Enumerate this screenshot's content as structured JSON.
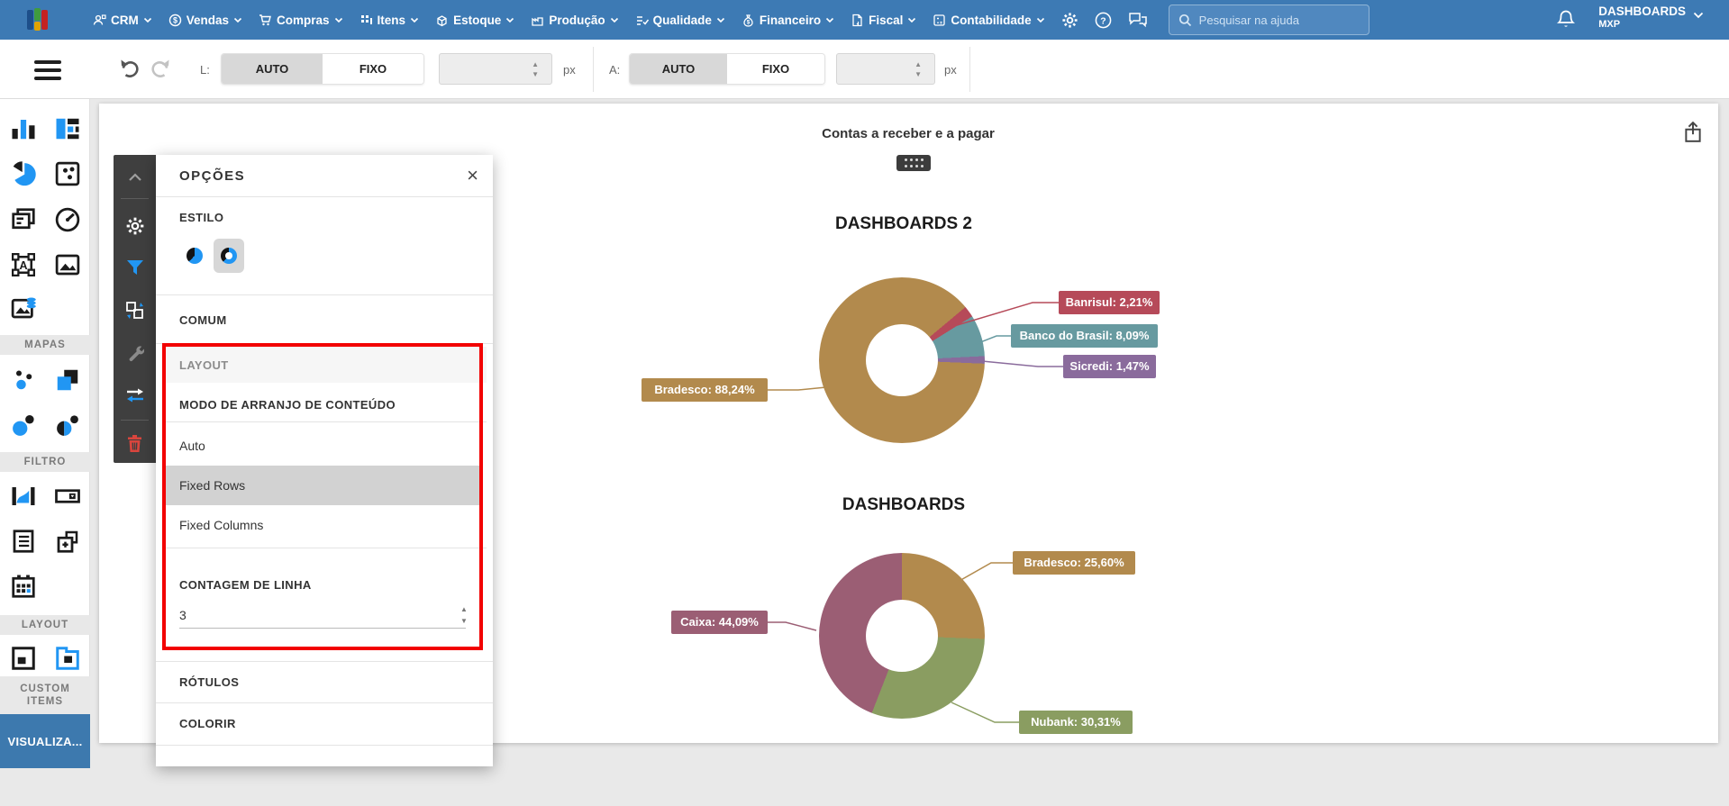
{
  "topbar": {
    "menus": [
      {
        "label": "CRM"
      },
      {
        "label": "Vendas"
      },
      {
        "label": "Compras"
      },
      {
        "label": "Itens"
      },
      {
        "label": "Estoque"
      },
      {
        "label": "Produção"
      },
      {
        "label": "Qualidade"
      },
      {
        "label": "Financeiro"
      },
      {
        "label": "Fiscal"
      },
      {
        "label": "Contabilidade"
      }
    ],
    "search": {
      "placeholder": "Pesquisar na ajuda"
    },
    "account": {
      "name": "DASHBOARDS",
      "org": "MXP"
    }
  },
  "toolbar": {
    "l_label": "L:",
    "a_label": "A:",
    "auto_label": "AUTO",
    "fixed_label": "FIXO",
    "px_label": "px"
  },
  "sidebar": {
    "section_labels": [
      "MAPAS",
      "FILTRO",
      "LAYOUT",
      "CUSTOM ITEMS"
    ],
    "visualize_label": "VISUALIZA..."
  },
  "options_panel": {
    "title": "OPÇÕES",
    "style_label": "ESTILO",
    "common_label": "COMUM",
    "layout_label": "LAYOUT",
    "arrange_label": "MODO DE ARRANJO DE CONTEÚDO",
    "arrange_options": [
      "Auto",
      "Fixed Rows",
      "Fixed Columns"
    ],
    "arrange_selected": "Fixed Rows",
    "row_count_label": "CONTAGEM DE LINHA",
    "row_count_value": "3",
    "labels_label": "RÓTULOS",
    "color_label": "COLORIR"
  },
  "canvas": {
    "title": "Contas a receber e a pagar"
  },
  "chart_data": [
    {
      "type": "pie",
      "subtype": "donut",
      "title": "DASHBOARDS 2",
      "start_angle": 92.4,
      "legend": false,
      "slices": [
        {
          "label": "Bradesco",
          "value": 88.24,
          "display": "Bradesco: 88,24%",
          "color": "#b28a4d"
        },
        {
          "label": "Banrisul",
          "value": 2.21,
          "display": "Banrisul: 2,21%",
          "color": "#b64a59"
        },
        {
          "label": "Banco do Brasil",
          "value": 8.09,
          "display": "Banco do Brasil: 8,09%",
          "color": "#679aa0"
        },
        {
          "label": "Sicredi",
          "value": 1.47,
          "display": "Sicredi: 1,47%",
          "color": "#8a6b9c"
        }
      ]
    },
    {
      "type": "pie",
      "subtype": "donut",
      "title": "DASHBOARDS",
      "start_angle": 0,
      "legend": false,
      "slices": [
        {
          "label": "Bradesco",
          "value": 25.6,
          "display": "Bradesco: 25,60%",
          "color": "#b28a4d"
        },
        {
          "label": "Nubank",
          "value": 30.31,
          "display": "Nubank: 30,31%",
          "color": "#8a9d61"
        },
        {
          "label": "Caixa",
          "value": 44.09,
          "display": "Caixa: 44,09%",
          "color": "#9b5e74"
        }
      ]
    }
  ]
}
